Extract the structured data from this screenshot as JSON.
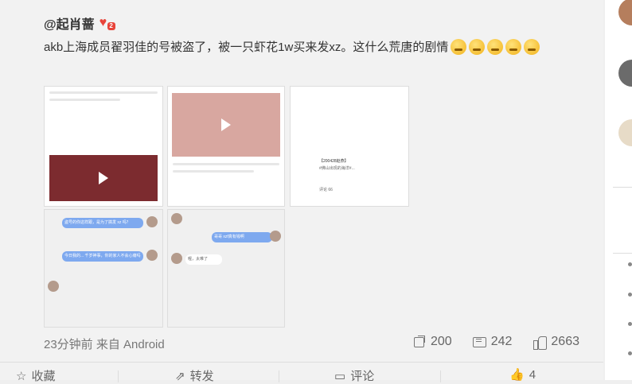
{
  "post": {
    "author": "@起肖蔷",
    "badge_count": "2",
    "text": "akb上海成员翟羽佳的号被盗了，被一只虾花1w买来发xz。这什么荒唐的剧情",
    "meta": "23分钟前 来自 Android",
    "reposts": "200",
    "comments": "242",
    "likes": "2663"
  },
  "actions": {
    "fav": "收藏",
    "repost": "转发",
    "comment": "评论",
    "like": "4"
  },
  "images": {
    "t3_title": "【200428赵燕】",
    "t3_sub": "#佛山出现的海洋#...",
    "t3_count": "评论 66",
    "t5_msg1": "哥哥 xzf真有钱啊",
    "t5_msg2": "喔，太难了",
    "t4_msg1": "盗号的你这样跟，是为了搞发 xz 吗？",
    "t4_msg2": "今日我的... 千岁神事，你的家人不会心痛吗"
  },
  "colors": {
    "bubble_blue": "#7ea9ef",
    "like_red": "#e8443a"
  }
}
